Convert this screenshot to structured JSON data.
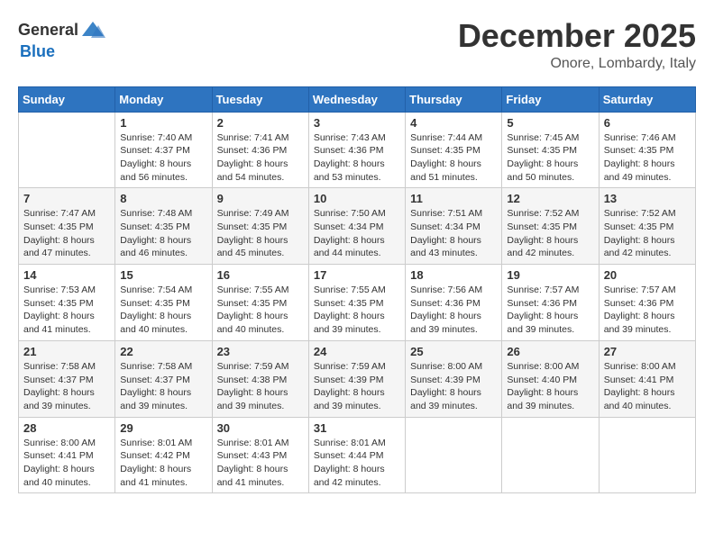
{
  "header": {
    "logo_general": "General",
    "logo_blue": "Blue",
    "month_title": "December 2025",
    "location": "Onore, Lombardy, Italy"
  },
  "weekdays": [
    "Sunday",
    "Monday",
    "Tuesday",
    "Wednesday",
    "Thursday",
    "Friday",
    "Saturday"
  ],
  "weeks": [
    [
      {
        "day": "",
        "info": ""
      },
      {
        "day": "1",
        "info": "Sunrise: 7:40 AM\nSunset: 4:37 PM\nDaylight: 8 hours\nand 56 minutes."
      },
      {
        "day": "2",
        "info": "Sunrise: 7:41 AM\nSunset: 4:36 PM\nDaylight: 8 hours\nand 54 minutes."
      },
      {
        "day": "3",
        "info": "Sunrise: 7:43 AM\nSunset: 4:36 PM\nDaylight: 8 hours\nand 53 minutes."
      },
      {
        "day": "4",
        "info": "Sunrise: 7:44 AM\nSunset: 4:35 PM\nDaylight: 8 hours\nand 51 minutes."
      },
      {
        "day": "5",
        "info": "Sunrise: 7:45 AM\nSunset: 4:35 PM\nDaylight: 8 hours\nand 50 minutes."
      },
      {
        "day": "6",
        "info": "Sunrise: 7:46 AM\nSunset: 4:35 PM\nDaylight: 8 hours\nand 49 minutes."
      }
    ],
    [
      {
        "day": "7",
        "info": "Sunrise: 7:47 AM\nSunset: 4:35 PM\nDaylight: 8 hours\nand 47 minutes."
      },
      {
        "day": "8",
        "info": "Sunrise: 7:48 AM\nSunset: 4:35 PM\nDaylight: 8 hours\nand 46 minutes."
      },
      {
        "day": "9",
        "info": "Sunrise: 7:49 AM\nSunset: 4:35 PM\nDaylight: 8 hours\nand 45 minutes."
      },
      {
        "day": "10",
        "info": "Sunrise: 7:50 AM\nSunset: 4:34 PM\nDaylight: 8 hours\nand 44 minutes."
      },
      {
        "day": "11",
        "info": "Sunrise: 7:51 AM\nSunset: 4:34 PM\nDaylight: 8 hours\nand 43 minutes."
      },
      {
        "day": "12",
        "info": "Sunrise: 7:52 AM\nSunset: 4:35 PM\nDaylight: 8 hours\nand 42 minutes."
      },
      {
        "day": "13",
        "info": "Sunrise: 7:52 AM\nSunset: 4:35 PM\nDaylight: 8 hours\nand 42 minutes."
      }
    ],
    [
      {
        "day": "14",
        "info": "Sunrise: 7:53 AM\nSunset: 4:35 PM\nDaylight: 8 hours\nand 41 minutes."
      },
      {
        "day": "15",
        "info": "Sunrise: 7:54 AM\nSunset: 4:35 PM\nDaylight: 8 hours\nand 40 minutes."
      },
      {
        "day": "16",
        "info": "Sunrise: 7:55 AM\nSunset: 4:35 PM\nDaylight: 8 hours\nand 40 minutes."
      },
      {
        "day": "17",
        "info": "Sunrise: 7:55 AM\nSunset: 4:35 PM\nDaylight: 8 hours\nand 39 minutes."
      },
      {
        "day": "18",
        "info": "Sunrise: 7:56 AM\nSunset: 4:36 PM\nDaylight: 8 hours\nand 39 minutes."
      },
      {
        "day": "19",
        "info": "Sunrise: 7:57 AM\nSunset: 4:36 PM\nDaylight: 8 hours\nand 39 minutes."
      },
      {
        "day": "20",
        "info": "Sunrise: 7:57 AM\nSunset: 4:36 PM\nDaylight: 8 hours\nand 39 minutes."
      }
    ],
    [
      {
        "day": "21",
        "info": "Sunrise: 7:58 AM\nSunset: 4:37 PM\nDaylight: 8 hours\nand 39 minutes."
      },
      {
        "day": "22",
        "info": "Sunrise: 7:58 AM\nSunset: 4:37 PM\nDaylight: 8 hours\nand 39 minutes."
      },
      {
        "day": "23",
        "info": "Sunrise: 7:59 AM\nSunset: 4:38 PM\nDaylight: 8 hours\nand 39 minutes."
      },
      {
        "day": "24",
        "info": "Sunrise: 7:59 AM\nSunset: 4:39 PM\nDaylight: 8 hours\nand 39 minutes."
      },
      {
        "day": "25",
        "info": "Sunrise: 8:00 AM\nSunset: 4:39 PM\nDaylight: 8 hours\nand 39 minutes."
      },
      {
        "day": "26",
        "info": "Sunrise: 8:00 AM\nSunset: 4:40 PM\nDaylight: 8 hours\nand 39 minutes."
      },
      {
        "day": "27",
        "info": "Sunrise: 8:00 AM\nSunset: 4:41 PM\nDaylight: 8 hours\nand 40 minutes."
      }
    ],
    [
      {
        "day": "28",
        "info": "Sunrise: 8:00 AM\nSunset: 4:41 PM\nDaylight: 8 hours\nand 40 minutes."
      },
      {
        "day": "29",
        "info": "Sunrise: 8:01 AM\nSunset: 4:42 PM\nDaylight: 8 hours\nand 41 minutes."
      },
      {
        "day": "30",
        "info": "Sunrise: 8:01 AM\nSunset: 4:43 PM\nDaylight: 8 hours\nand 41 minutes."
      },
      {
        "day": "31",
        "info": "Sunrise: 8:01 AM\nSunset: 4:44 PM\nDaylight: 8 hours\nand 42 minutes."
      },
      {
        "day": "",
        "info": ""
      },
      {
        "day": "",
        "info": ""
      },
      {
        "day": "",
        "info": ""
      }
    ]
  ]
}
